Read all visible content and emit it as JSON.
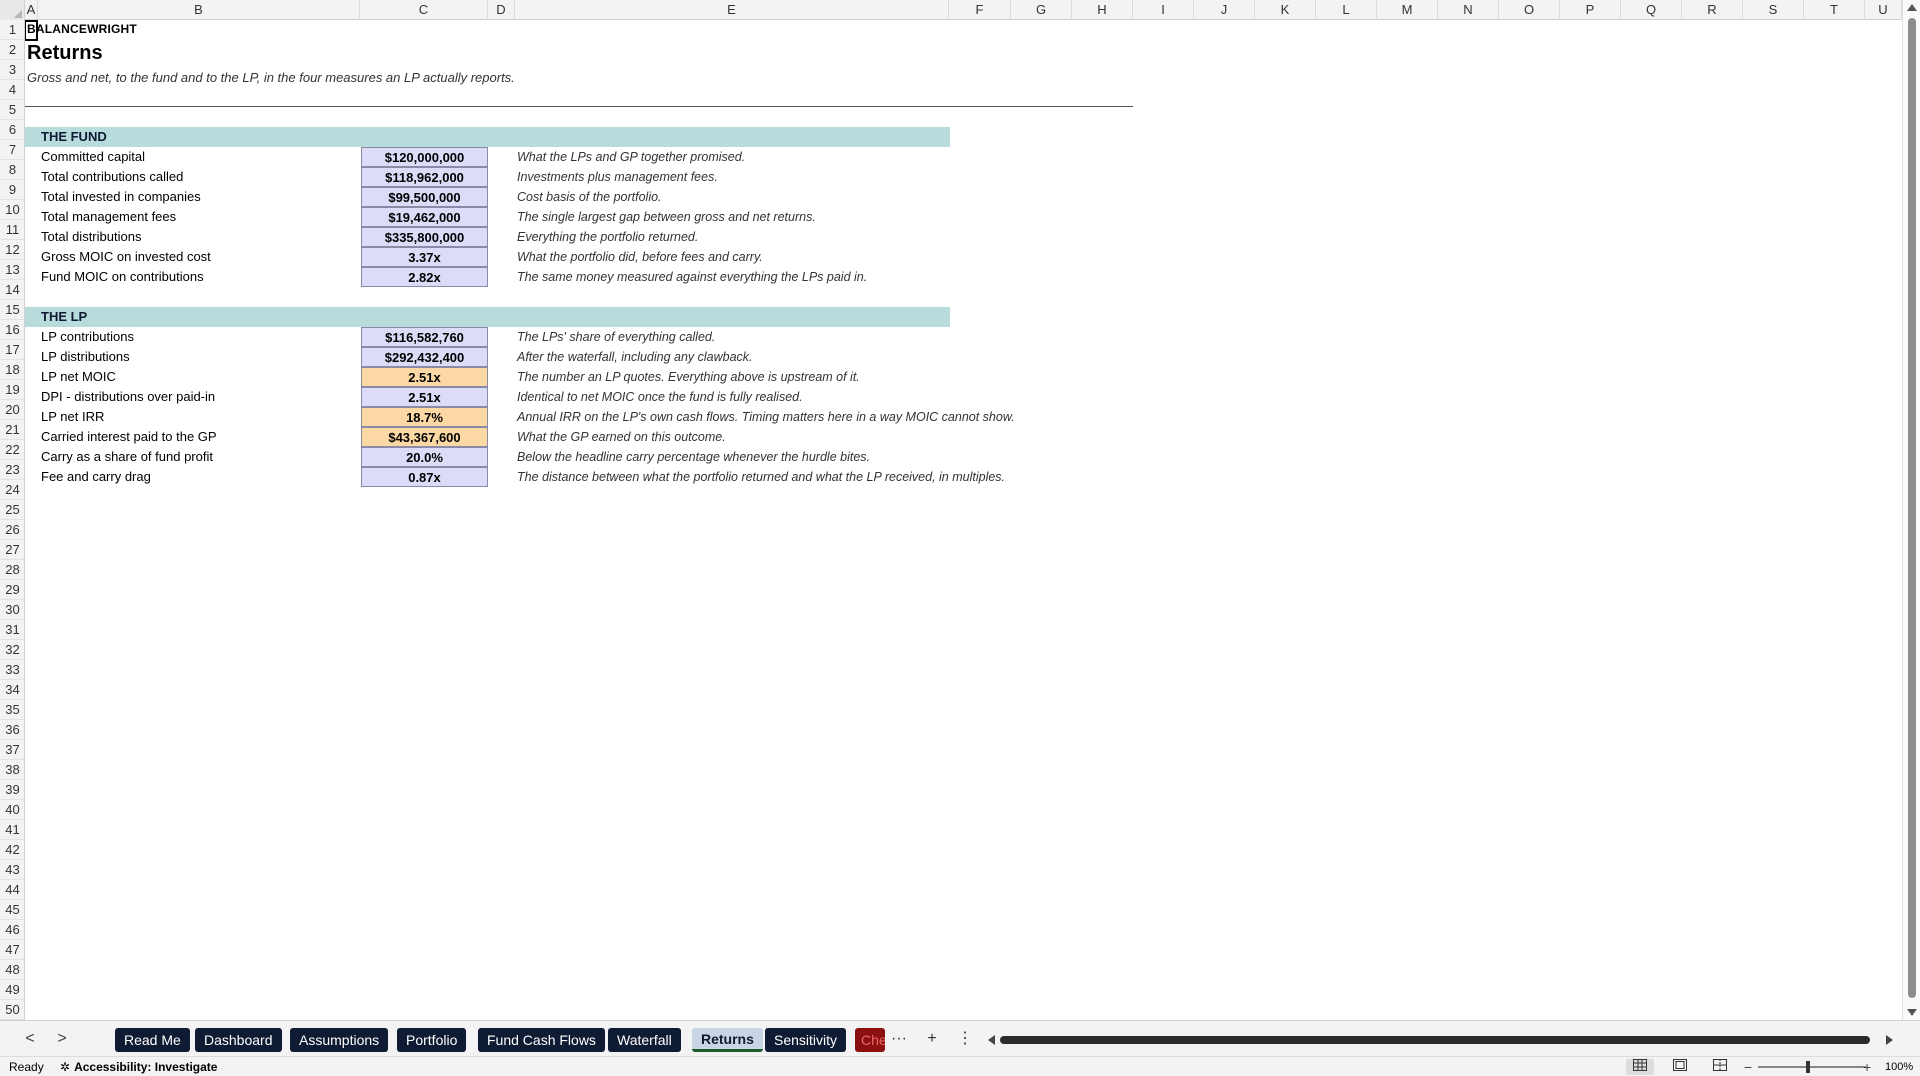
{
  "columns": [
    "A",
    "B",
    "C",
    "D",
    "E",
    "F",
    "G",
    "H",
    "I",
    "J",
    "K",
    "L",
    "M",
    "N",
    "O",
    "P",
    "Q",
    "R",
    "S",
    "T",
    "U"
  ],
  "rows": [
    "1",
    "2",
    "3",
    "4",
    "5",
    "6",
    "7",
    "8",
    "9",
    "10",
    "11",
    "12",
    "13",
    "14",
    "15",
    "16",
    "17",
    "18",
    "19",
    "20",
    "21",
    "22",
    "23",
    "24",
    "25",
    "26",
    "27",
    "28",
    "29",
    "30",
    "31",
    "32",
    "33",
    "34",
    "35",
    "36",
    "37",
    "38",
    "39",
    "40",
    "41",
    "42",
    "43",
    "44",
    "45",
    "46",
    "47",
    "48",
    "49",
    "50"
  ],
  "sheet": {
    "brand": "BALANCEWRIGHT",
    "title": "Returns",
    "subtitle": "Gross and net, to the fund and to the LP, in the four measures an LP actually reports.",
    "fund_section": {
      "heading": "THE FUND",
      "rows": [
        {
          "label": "Committed capital",
          "value": "$120,000,000",
          "note": "What the LPs and GP together promised."
        },
        {
          "label": "Total contributions called",
          "value": "$118,962,000",
          "note": "Investments plus management fees."
        },
        {
          "label": "Total invested in companies",
          "value": "$99,500,000",
          "note": "Cost basis of the portfolio."
        },
        {
          "label": "Total management fees",
          "value": "$19,462,000",
          "note": "The single largest gap between gross and net returns."
        },
        {
          "label": "Total distributions",
          "value": "$335,800,000",
          "note": "Everything the portfolio returned."
        },
        {
          "label": "Gross MOIC on invested cost",
          "value": "3.37x",
          "note": "What the portfolio did, before fees and carry."
        },
        {
          "label": "Fund MOIC on contributions",
          "value": "2.82x",
          "note": "The same money measured against everything the LPs paid in."
        }
      ]
    },
    "lp_section": {
      "heading": "THE LP",
      "rows": [
        {
          "label": "LP contributions",
          "value": "$116,582,760",
          "note": "The LPs' share of everything called."
        },
        {
          "label": "LP distributions",
          "value": "$292,432,400",
          "note": "After the waterfall, including any clawback."
        },
        {
          "label": "LP net MOIC",
          "value": "2.51x",
          "note": "The number an LP quotes. Everything above is upstream of it."
        },
        {
          "label": "DPI - distributions over paid-in",
          "value": "2.51x",
          "note": "Identical to net MOIC once the fund is fully realised."
        },
        {
          "label": "LP net IRR",
          "value": "18.7%",
          "note": "Annual IRR on the LP's own cash flows. Timing matters here in a way MOIC cannot show."
        },
        {
          "label": "Carried interest paid to the GP",
          "value": "$43,367,600",
          "note": "What the GP earned on this outcome."
        },
        {
          "label": "Carry as a share of fund profit",
          "value": "20.0%",
          "note": "Below the headline carry percentage whenever the hurdle bites."
        },
        {
          "label": "Fee and carry drag",
          "value": "0.87x",
          "note": "The distance between what the portfolio returned and what the LP received, in multiples."
        }
      ]
    }
  },
  "tabs": [
    {
      "label": "Read Me"
    },
    {
      "label": "Dashboard"
    },
    {
      "label": "Assumptions"
    },
    {
      "label": "Portfolio"
    },
    {
      "label": "Fund Cash Flows"
    },
    {
      "label": "Waterfall"
    },
    {
      "label": "Returns"
    },
    {
      "label": "Sensitivity"
    },
    {
      "label": "Che"
    }
  ],
  "tabbar": {
    "prev": "<",
    "next": ">",
    "more": "···",
    "add": "+",
    "options": "⋮"
  },
  "status": {
    "ready": "Ready",
    "accessibility": "Accessibility: Investigate",
    "zoom": "100%"
  },
  "colors": {
    "section_bg": "#b8dcdc",
    "value_bg": "#dcdcf8",
    "highlight_bg": "#fcd9a4",
    "tab_bg": "#0f1a33"
  },
  "icons": [
    "accessibility-icon",
    "normal-view-icon",
    "page-layout-icon",
    "page-break-icon"
  ]
}
